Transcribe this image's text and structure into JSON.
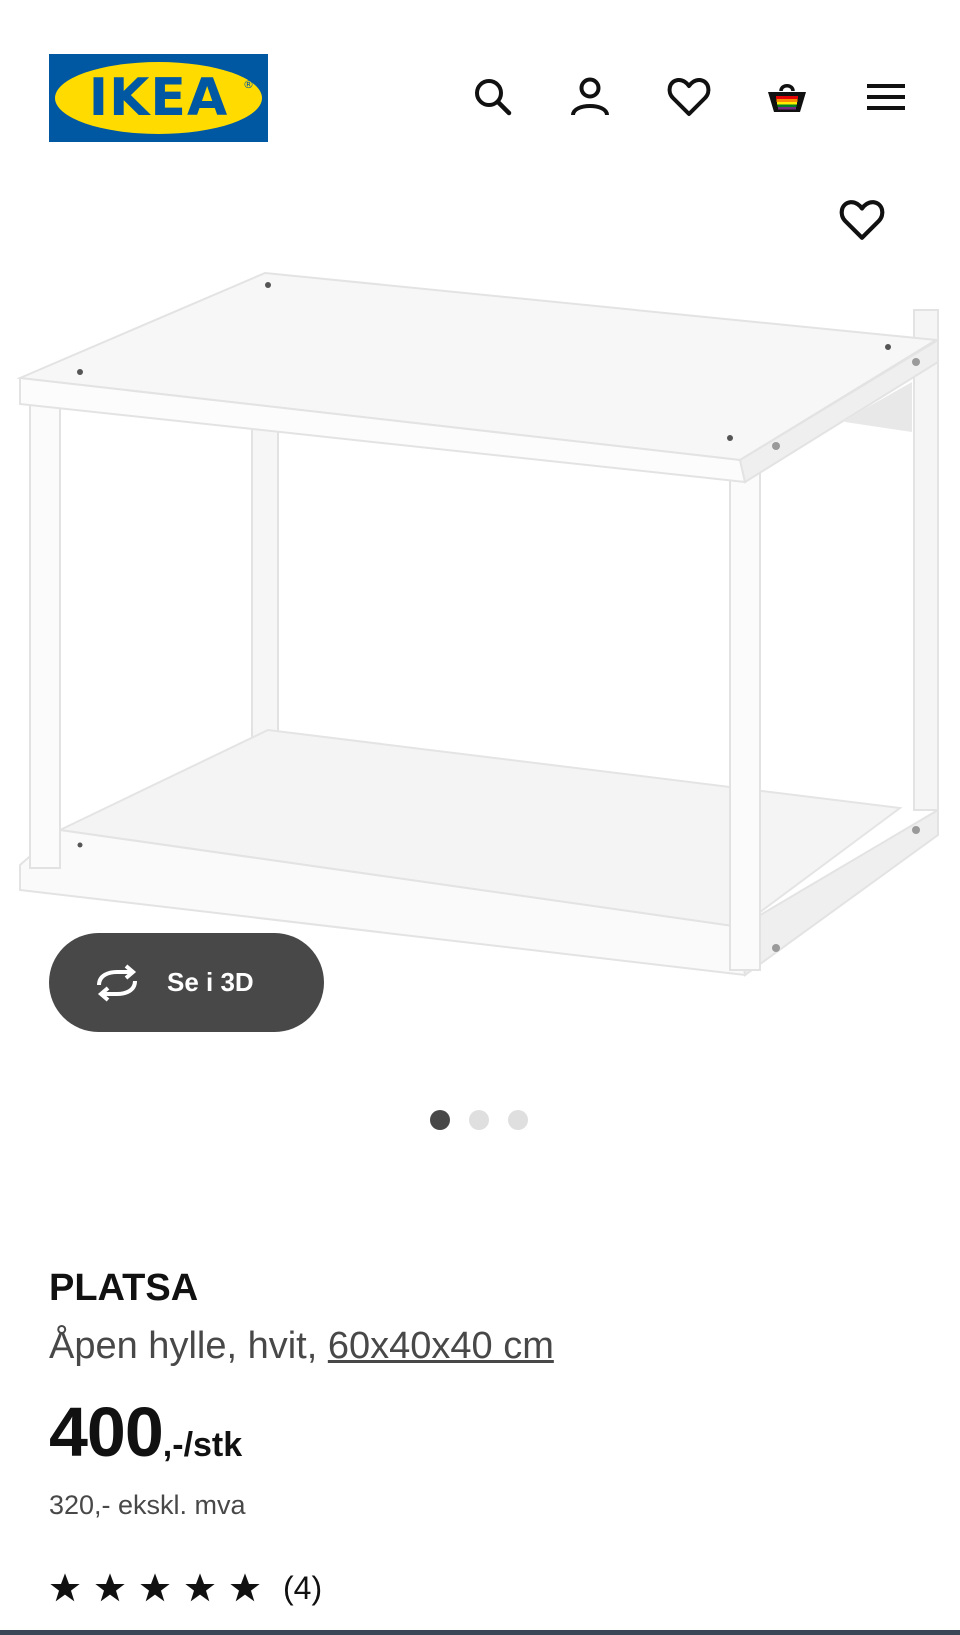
{
  "header": {
    "logo_text": "IKEA",
    "logo_registered": "®",
    "colors": {
      "logo_blue": "#0058a3",
      "logo_yellow": "#ffdb00"
    },
    "icons": [
      "search-icon",
      "account-icon",
      "heart-icon",
      "cart-icon",
      "menu-icon"
    ]
  },
  "gallery": {
    "favorite_icon": "heart-icon",
    "view_3d_label": "Se i 3D",
    "view_3d_icon": "rotate-icon",
    "slide_count": 3,
    "active_slide": 1
  },
  "product": {
    "name": "PLATSA",
    "description": "Åpen hylle, hvit, ",
    "measurement": "60x40x40 cm",
    "price_integer": "400",
    "price_suffix": ",-/stk",
    "price_excl_vat": "320,- ekskl. mva",
    "rating_stars": 5,
    "rating_count": "(4)"
  }
}
